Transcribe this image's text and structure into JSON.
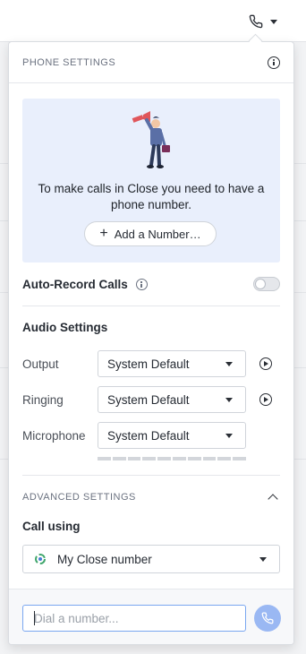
{
  "topbar": {
    "phone_icon": "phone-icon",
    "dropdown_icon": "chevron-down-icon"
  },
  "panel": {
    "title": "PHONE SETTINGS",
    "info_icon": "info-icon"
  },
  "promo": {
    "illustration": "person-with-megaphone-illustration",
    "message": "To make calls in Close you need to have a phone number.",
    "add_number_label": "Add a Number…"
  },
  "auto_record": {
    "label": "Auto-Record Calls",
    "enabled": false
  },
  "audio_settings": {
    "title": "Audio Settings",
    "output": {
      "label": "Output",
      "value": "System Default"
    },
    "ringing": {
      "label": "Ringing",
      "value": "System Default"
    },
    "microphone": {
      "label": "Microphone",
      "value": "System Default",
      "level": 0
    }
  },
  "advanced": {
    "title": "ADVANCED SETTINGS",
    "expanded": true,
    "call_using_label": "Call using",
    "call_using_value": "My Close number"
  },
  "dialer": {
    "placeholder": "Dial a number...",
    "value": ""
  },
  "colors": {
    "accent": "#9ab8f3",
    "promo_bg": "#e9effc",
    "input_focus": "#7aa7f0"
  }
}
